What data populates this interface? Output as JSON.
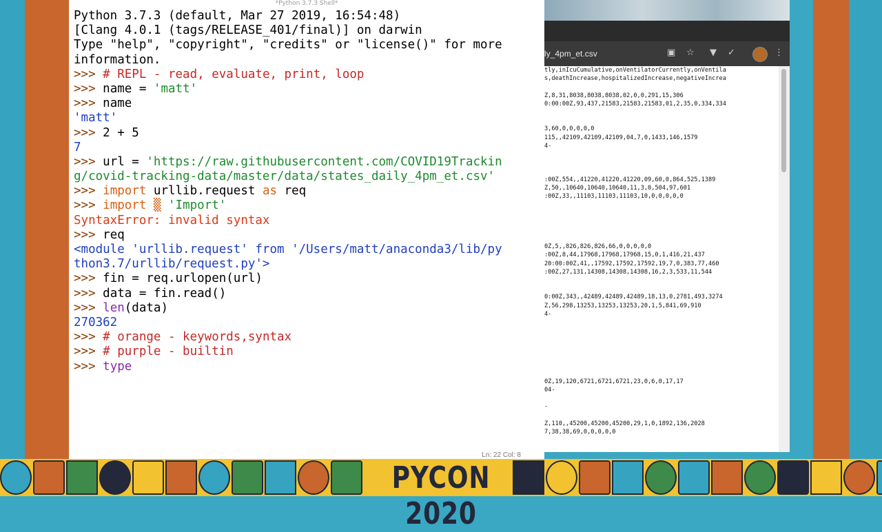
{
  "shell": {
    "title": "*Python 3.7.3 Shell*",
    "status": "Ln: 22   Col: 8",
    "lines": [
      [
        {
          "t": "Python 3.7.3 (default, Mar 27 2019, 16:54:48)",
          "c": ""
        }
      ],
      [
        {
          "t": "[Clang 4.0.1 (tags/RELEASE_401/final)] on darwin",
          "c": ""
        }
      ],
      [
        {
          "t": "Type \"help\", \"copyright\", \"credits\" or \"license()\" for more",
          "c": ""
        }
      ],
      [
        {
          "t": "information.",
          "c": ""
        }
      ],
      [
        {
          "t": ">>> ",
          "c": "prompt"
        },
        {
          "t": "# REPL - read, evaluate, print, loop",
          "c": "cmt"
        }
      ],
      [
        {
          "t": ">>> ",
          "c": "prompt"
        },
        {
          "t": "name = ",
          "c": ""
        },
        {
          "t": "'matt'",
          "c": "str"
        }
      ],
      [
        {
          "t": ">>> ",
          "c": "prompt"
        },
        {
          "t": "name",
          "c": ""
        }
      ],
      [
        {
          "t": "'matt'",
          "c": "out"
        }
      ],
      [
        {
          "t": ">>> ",
          "c": "prompt"
        },
        {
          "t": "2 + 5",
          "c": ""
        }
      ],
      [
        {
          "t": "7",
          "c": "out"
        }
      ],
      [
        {
          "t": ">>> ",
          "c": "prompt"
        },
        {
          "t": "url = ",
          "c": ""
        },
        {
          "t": "'https://raw.githubusercontent.com/COVID19Trackin",
          "c": "str"
        }
      ],
      [
        {
          "t": "g/covid-tracking-data/master/data/states_daily_4pm_et.csv'",
          "c": "str"
        }
      ],
      [
        {
          "t": ">>> ",
          "c": "prompt"
        },
        {
          "t": "import",
          "c": "kw"
        },
        {
          "t": " urllib.request ",
          "c": ""
        },
        {
          "t": "as",
          "c": "kw"
        },
        {
          "t": " req",
          "c": ""
        }
      ],
      [
        {
          "t": ">>> ",
          "c": "prompt"
        },
        {
          "t": "import",
          "c": "kw"
        },
        {
          "t": " ",
          "c": ""
        },
        {
          "t": "▒",
          "c": "kw"
        },
        {
          "t": " ",
          "c": ""
        },
        {
          "t": "'Import'",
          "c": "str"
        }
      ],
      [
        {
          "t": "SyntaxError: invalid syntax",
          "c": "err"
        }
      ],
      [
        {
          "t": ">>> ",
          "c": "prompt"
        },
        {
          "t": "req",
          "c": ""
        }
      ],
      [
        {
          "t": "<module 'urllib.request' from '/Users/matt/anaconda3/lib/py",
          "c": "out"
        }
      ],
      [
        {
          "t": "thon3.7/urllib/request.py'>",
          "c": "out"
        }
      ],
      [
        {
          "t": ">>> ",
          "c": "prompt"
        },
        {
          "t": "fin = req.urlopen(url)",
          "c": ""
        }
      ],
      [
        {
          "t": ">>> ",
          "c": "prompt"
        },
        {
          "t": "data = fin.read()",
          "c": ""
        }
      ],
      [
        {
          "t": ">>> ",
          "c": "prompt"
        },
        {
          "t": "len",
          "c": "bi"
        },
        {
          "t": "(data)",
          "c": ""
        }
      ],
      [
        {
          "t": "270362",
          "c": "out"
        }
      ],
      [
        {
          "t": ">>> ",
          "c": "prompt"
        },
        {
          "t": "# orange - keywords,syntax",
          "c": "cmt"
        }
      ],
      [
        {
          "t": ">>> ",
          "c": "prompt"
        },
        {
          "t": "# purple - builtin",
          "c": "cmt"
        }
      ],
      [
        {
          "t": ">>> ",
          "c": "prompt"
        },
        {
          "t": "type",
          "c": "bi"
        }
      ]
    ]
  },
  "browser": {
    "url": "ly_4pm_et.csv",
    "icons": [
      "camera-icon",
      "star-icon",
      "extension-icon",
      "check-icon",
      "avatar",
      "menu-icon"
    ],
    "csv_lines": [
      "tly,inIcuCumulative,onVentilatorCurrently,onVentila",
      "s,deathIncrease,hospitalizedIncrease,negativeIncrea",
      "",
      "Z,8,31,8038,8038,8038,02,0,0,291,15,306",
      "0:00:00Z,93,437,21583,21583,21583,01,2,35,0,334,334",
      "",
      "",
      "3,60,0,0,0,0,0",
      "115,,42109,42109,42109,04,7,0,1433,146,1579",
      "4-",
      "",
      "",
      "",
      ":00Z,554,,41220,41220,41220,09,60,0,864,525,1389",
      "Z,50,,10640,10640,10640,11,3,0,504,97,601",
      ":00Z,33,,11103,11103,11103,10,0,0,0,0,0",
      "",
      "",
      "",
      "",
      "",
      "0Z,5,,826,826,826,66,0,0,0,0,0",
      ":00Z,8,44,17968,17968,17968,15,0,1,416,21,437",
      "20:00:00Z,41,,17592,17592,17592,19,7,0,383,77,460",
      ":00Z,27,131,14308,14308,14308,16,2,3,533,11,544",
      "",
      "",
      "0:00Z,343,,42489,42489,42489,18,13,0,2781,493,3274",
      "Z,56,298,13253,13253,13253,20,1,5,841,69,910",
      "4-",
      "",
      "",
      "",
      "",
      "",
      "",
      "",
      "0Z,19,120,6721,6721,6721,23,0,6,0,17,17",
      "04-",
      "",
      "-",
      "",
      "Z,110,,45200,45200,45200,29,1,0,1892,136,2028",
      "7,38,38,69,0,0,0,0,0"
    ]
  },
  "banner": {
    "logo_text": "PYCON 2020",
    "colors": {
      "gold": "#f2c230",
      "navy": "#23283a",
      "orange": "#c8662e",
      "teal": "#36a3c1",
      "green": "#3d8a4a"
    }
  }
}
